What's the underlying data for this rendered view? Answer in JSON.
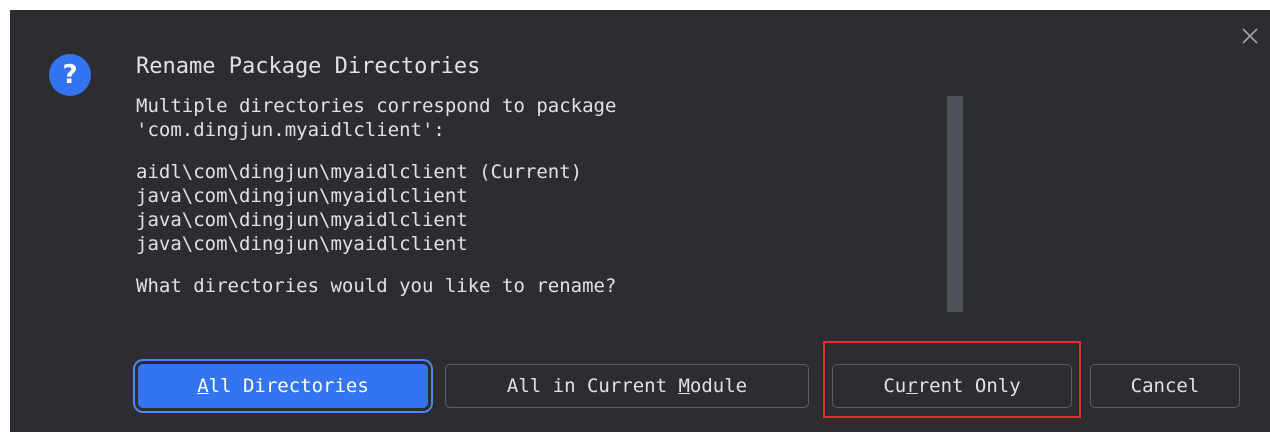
{
  "dialog": {
    "title": "Rename Package Directories",
    "message_lines": [
      "Multiple directories correspond to package",
      "'com.dingjun.myaidlclient':",
      "",
      "aidl\\com\\dingjun\\myaidlclient (Current)",
      "java\\com\\dingjun\\myaidlclient",
      "java\\com\\dingjun\\myaidlclient",
      "java\\com\\dingjun\\myaidlclient",
      "",
      "What directories would you like to rename?"
    ],
    "close_icon": "close-icon",
    "dialog_icon": "question-icon",
    "question_glyph": "?"
  },
  "buttons": {
    "all_directories": {
      "mnemonic": "A",
      "rest": "ll Directories"
    },
    "all_in_current_module": {
      "pre": "All in Current ",
      "mnemonic": "M",
      "rest": "odule"
    },
    "current_only": {
      "pre": "Cu",
      "mnemonic": "r",
      "rest": "rent Only"
    },
    "cancel": {
      "label": "Cancel"
    }
  },
  "colors": {
    "dialog_bg": "#2b2d30",
    "text": "#dfe1e5",
    "accent": "#3574f0",
    "highlight": "#e03030"
  }
}
